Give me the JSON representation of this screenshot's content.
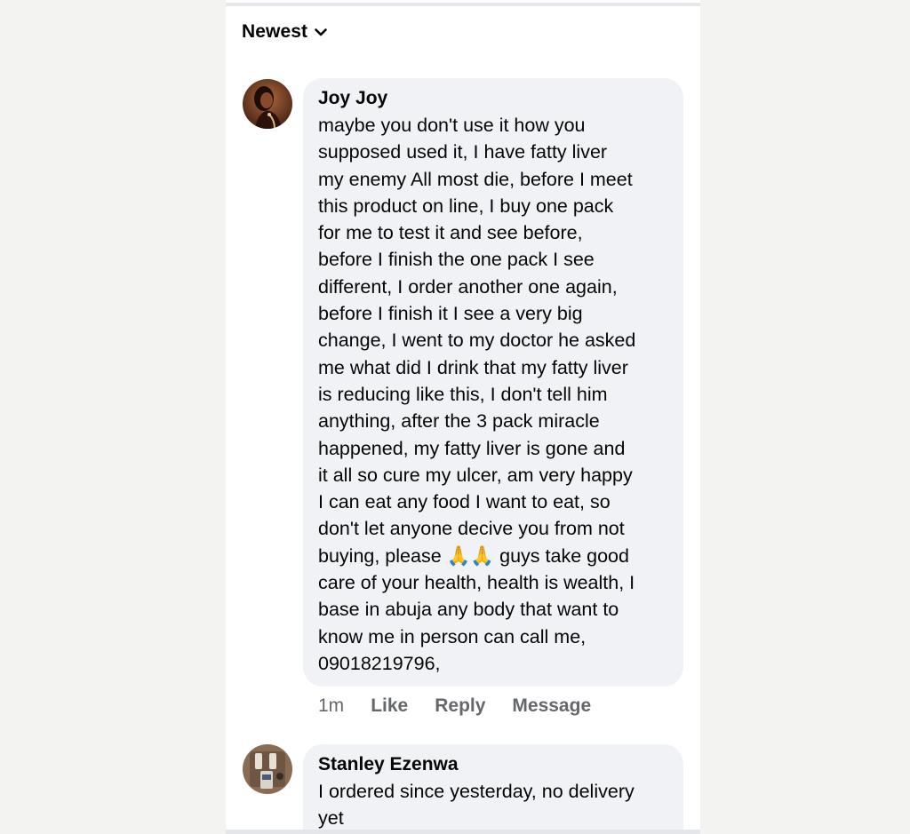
{
  "sort": {
    "label": "Newest",
    "icon": "chevron-down-icon"
  },
  "comments": [
    {
      "author": "Joy Joy",
      "text": "maybe you don't use it how you\nsupposed used it, I have fatty liver\nmy enemy All most die, before I meet\nthis product on line, I buy one pack\nfor me to test it and see before,\nbefore I finish the one pack I see\ndifferent, I order another one again,\nbefore I finish it I see a very big\nchange, I went to my doctor he asked\nme what did I drink that my fatty liver\nis reducing like this, I don't tell him\nanything, after the 3 pack miracle\nhappened, my fatty liver is gone and\nit all so cure my ulcer, am very happy\nI can eat any food I want to eat, so\ndon't let anyone decive you from not\nbuying, please 🙏🙏 guys take good\ncare of your health, health is wealth, I\nbase in abuja any body that want to\nknow me in person can call me,\n09018219796,",
      "time": "1m",
      "actions": [
        "Like",
        "Reply",
        "Message"
      ]
    },
    {
      "author": "Stanley Ezenwa",
      "text": "I ordered since yesterday, no delivery\nyet"
    }
  ],
  "colors": {
    "page_background": "#f3f3f1",
    "panel_background": "#ffffff",
    "bubble_background": "#f0f2f5",
    "primary_text": "#050505",
    "secondary_text": "#65676b"
  }
}
